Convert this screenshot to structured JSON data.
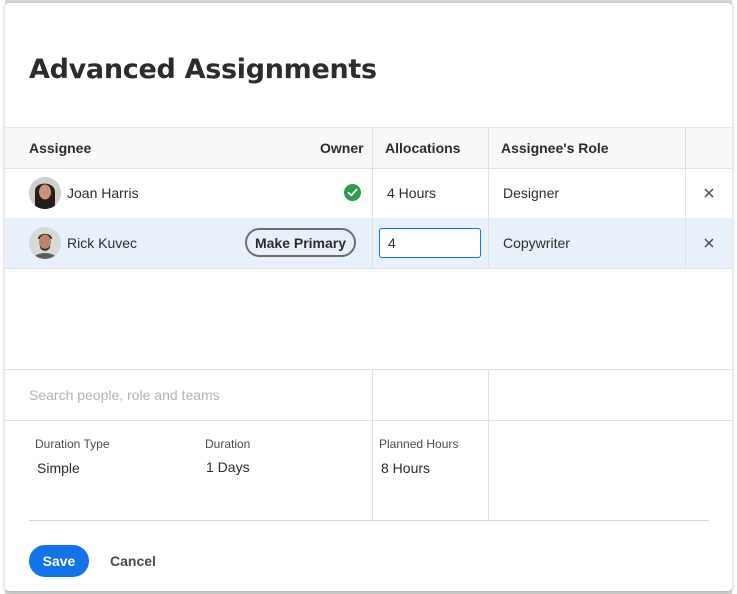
{
  "dialog": {
    "title": "Advanced Assignments"
  },
  "table": {
    "columns": {
      "assignee": "Assignee",
      "owner": "Owner",
      "allocations": "Allocations",
      "role": "Assignee's Role"
    },
    "rows": [
      {
        "name": "Joan Harris",
        "owner_icon": "check-circle-icon",
        "allocation": "4 Hours",
        "role": "Designer",
        "remove_icon": "close-icon"
      },
      {
        "name": "Rick Kuvec",
        "make_primary_label": "Make Primary",
        "allocation_value": "4",
        "role": "Copywriter",
        "remove_icon": "close-icon"
      }
    ]
  },
  "search": {
    "placeholder": "Search people, role and teams"
  },
  "details": {
    "duration_type_label": "Duration Type",
    "duration_type_value": "Simple",
    "duration_label": "Duration",
    "duration_value": "1 Days",
    "planned_hours_label": "Planned Hours",
    "planned_hours_value": "8 Hours"
  },
  "footer": {
    "save_label": "Save",
    "cancel_label": "Cancel"
  },
  "colors": {
    "accent": "#1473e6",
    "selected_row": "#e8f0fb",
    "owner_check": "#2d9d4d"
  }
}
